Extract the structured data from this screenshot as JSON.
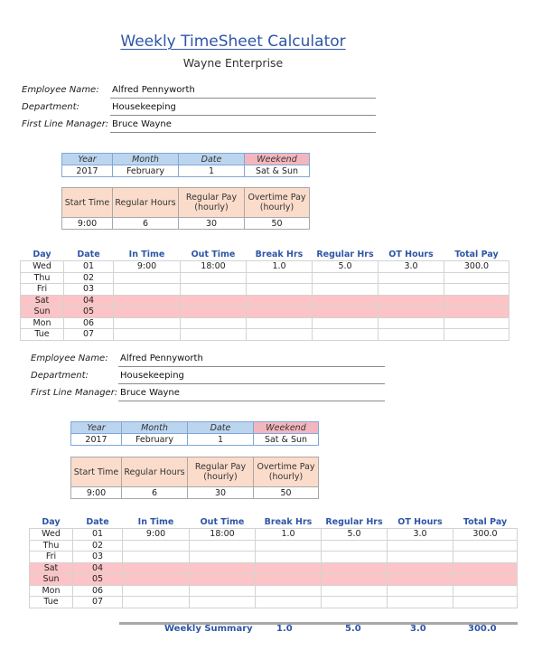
{
  "header": {
    "title": "Weekly TimeSheet Calculator",
    "company": "Wayne Enterprise"
  },
  "sections": [
    {
      "employee": {
        "name_label": "Employee Name:",
        "name_value": "Alfred Pennyworth",
        "department_label": "Department:",
        "department_value": "Housekeeping",
        "manager_label": "First Line Manager:",
        "manager_value": "Bruce Wayne"
      },
      "meta": {
        "headers": [
          "Year",
          "Month",
          "Date",
          "Weekend"
        ],
        "values": [
          "2017",
          "February",
          "1",
          "Sat & Sun"
        ]
      },
      "pay": {
        "headers": [
          "Start Time",
          "Regular Hours",
          "Regular Pay (hourly)",
          "Overtime Pay (hourly)"
        ],
        "values": [
          "9:00",
          "6",
          "30",
          "50"
        ]
      },
      "week": {
        "columns": [
          "Day",
          "Date",
          "In Time",
          "Out Time",
          "Break Hrs",
          "Regular Hrs",
          "OT Hours",
          "Total Pay"
        ],
        "rows": [
          [
            "Wed",
            "01",
            "9:00",
            "18:00",
            "1.0",
            "5.0",
            "3.0",
            "300.0"
          ],
          [
            "Thu",
            "02",
            "",
            "",
            "",
            "",
            "",
            ""
          ],
          [
            "Fri",
            "03",
            "",
            "",
            "",
            "",
            "",
            ""
          ],
          [
            "Sat",
            "04",
            "",
            "",
            "",
            "",
            "",
            ""
          ],
          [
            "Sun",
            "05",
            "",
            "",
            "",
            "",
            "",
            ""
          ],
          [
            "Mon",
            "06",
            "",
            "",
            "",
            "",
            "",
            ""
          ],
          [
            "Tue",
            "07",
            "",
            "",
            "",
            "",
            "",
            ""
          ]
        ]
      }
    },
    {
      "employee": {
        "name_label": "Employee Name:",
        "name_value": "Alfred Pennyworth",
        "department_label": "Department:",
        "department_value": "Housekeeping",
        "manager_label": "First Line Manager:",
        "manager_value": "Bruce Wayne"
      },
      "meta": {
        "headers": [
          "Year",
          "Month",
          "Date",
          "Weekend"
        ],
        "values": [
          "2017",
          "February",
          "1",
          "Sat & Sun"
        ]
      },
      "pay": {
        "headers": [
          "Start Time",
          "Regular Hours",
          "Regular Pay (hourly)",
          "Overtime Pay (hourly)"
        ],
        "values": [
          "9:00",
          "6",
          "30",
          "50"
        ]
      },
      "week": {
        "columns": [
          "Day",
          "Date",
          "In Time",
          "Out Time",
          "Break Hrs",
          "Regular Hrs",
          "OT Hours",
          "Total Pay"
        ],
        "rows": [
          [
            "Wed",
            "01",
            "9:00",
            "18:00",
            "1.0",
            "5.0",
            "3.0",
            "300.0"
          ],
          [
            "Thu",
            "02",
            "",
            "",
            "",
            "",
            "",
            ""
          ],
          [
            "Fri",
            "03",
            "",
            "",
            "",
            "",
            "",
            ""
          ],
          [
            "Sat",
            "04",
            "",
            "",
            "",
            "",
            "",
            ""
          ],
          [
            "Sun",
            "05",
            "",
            "",
            "",
            "",
            "",
            ""
          ],
          [
            "Mon",
            "06",
            "",
            "",
            "",
            "",
            "",
            ""
          ],
          [
            "Tue",
            "07",
            "",
            "",
            "",
            "",
            "",
            ""
          ]
        ]
      }
    }
  ],
  "summary": {
    "label": "Weekly Summary",
    "break_hrs": "1.0",
    "regular_hrs": "5.0",
    "ot_hours": "3.0",
    "total_pay": "300.0"
  },
  "colors": {
    "accent": "#2f56a6",
    "meta_header": "#bcd5ef",
    "weekend_header": "#f4b6be",
    "pay_header": "#fbdccb",
    "weekend_row": "#fcc4c6"
  }
}
